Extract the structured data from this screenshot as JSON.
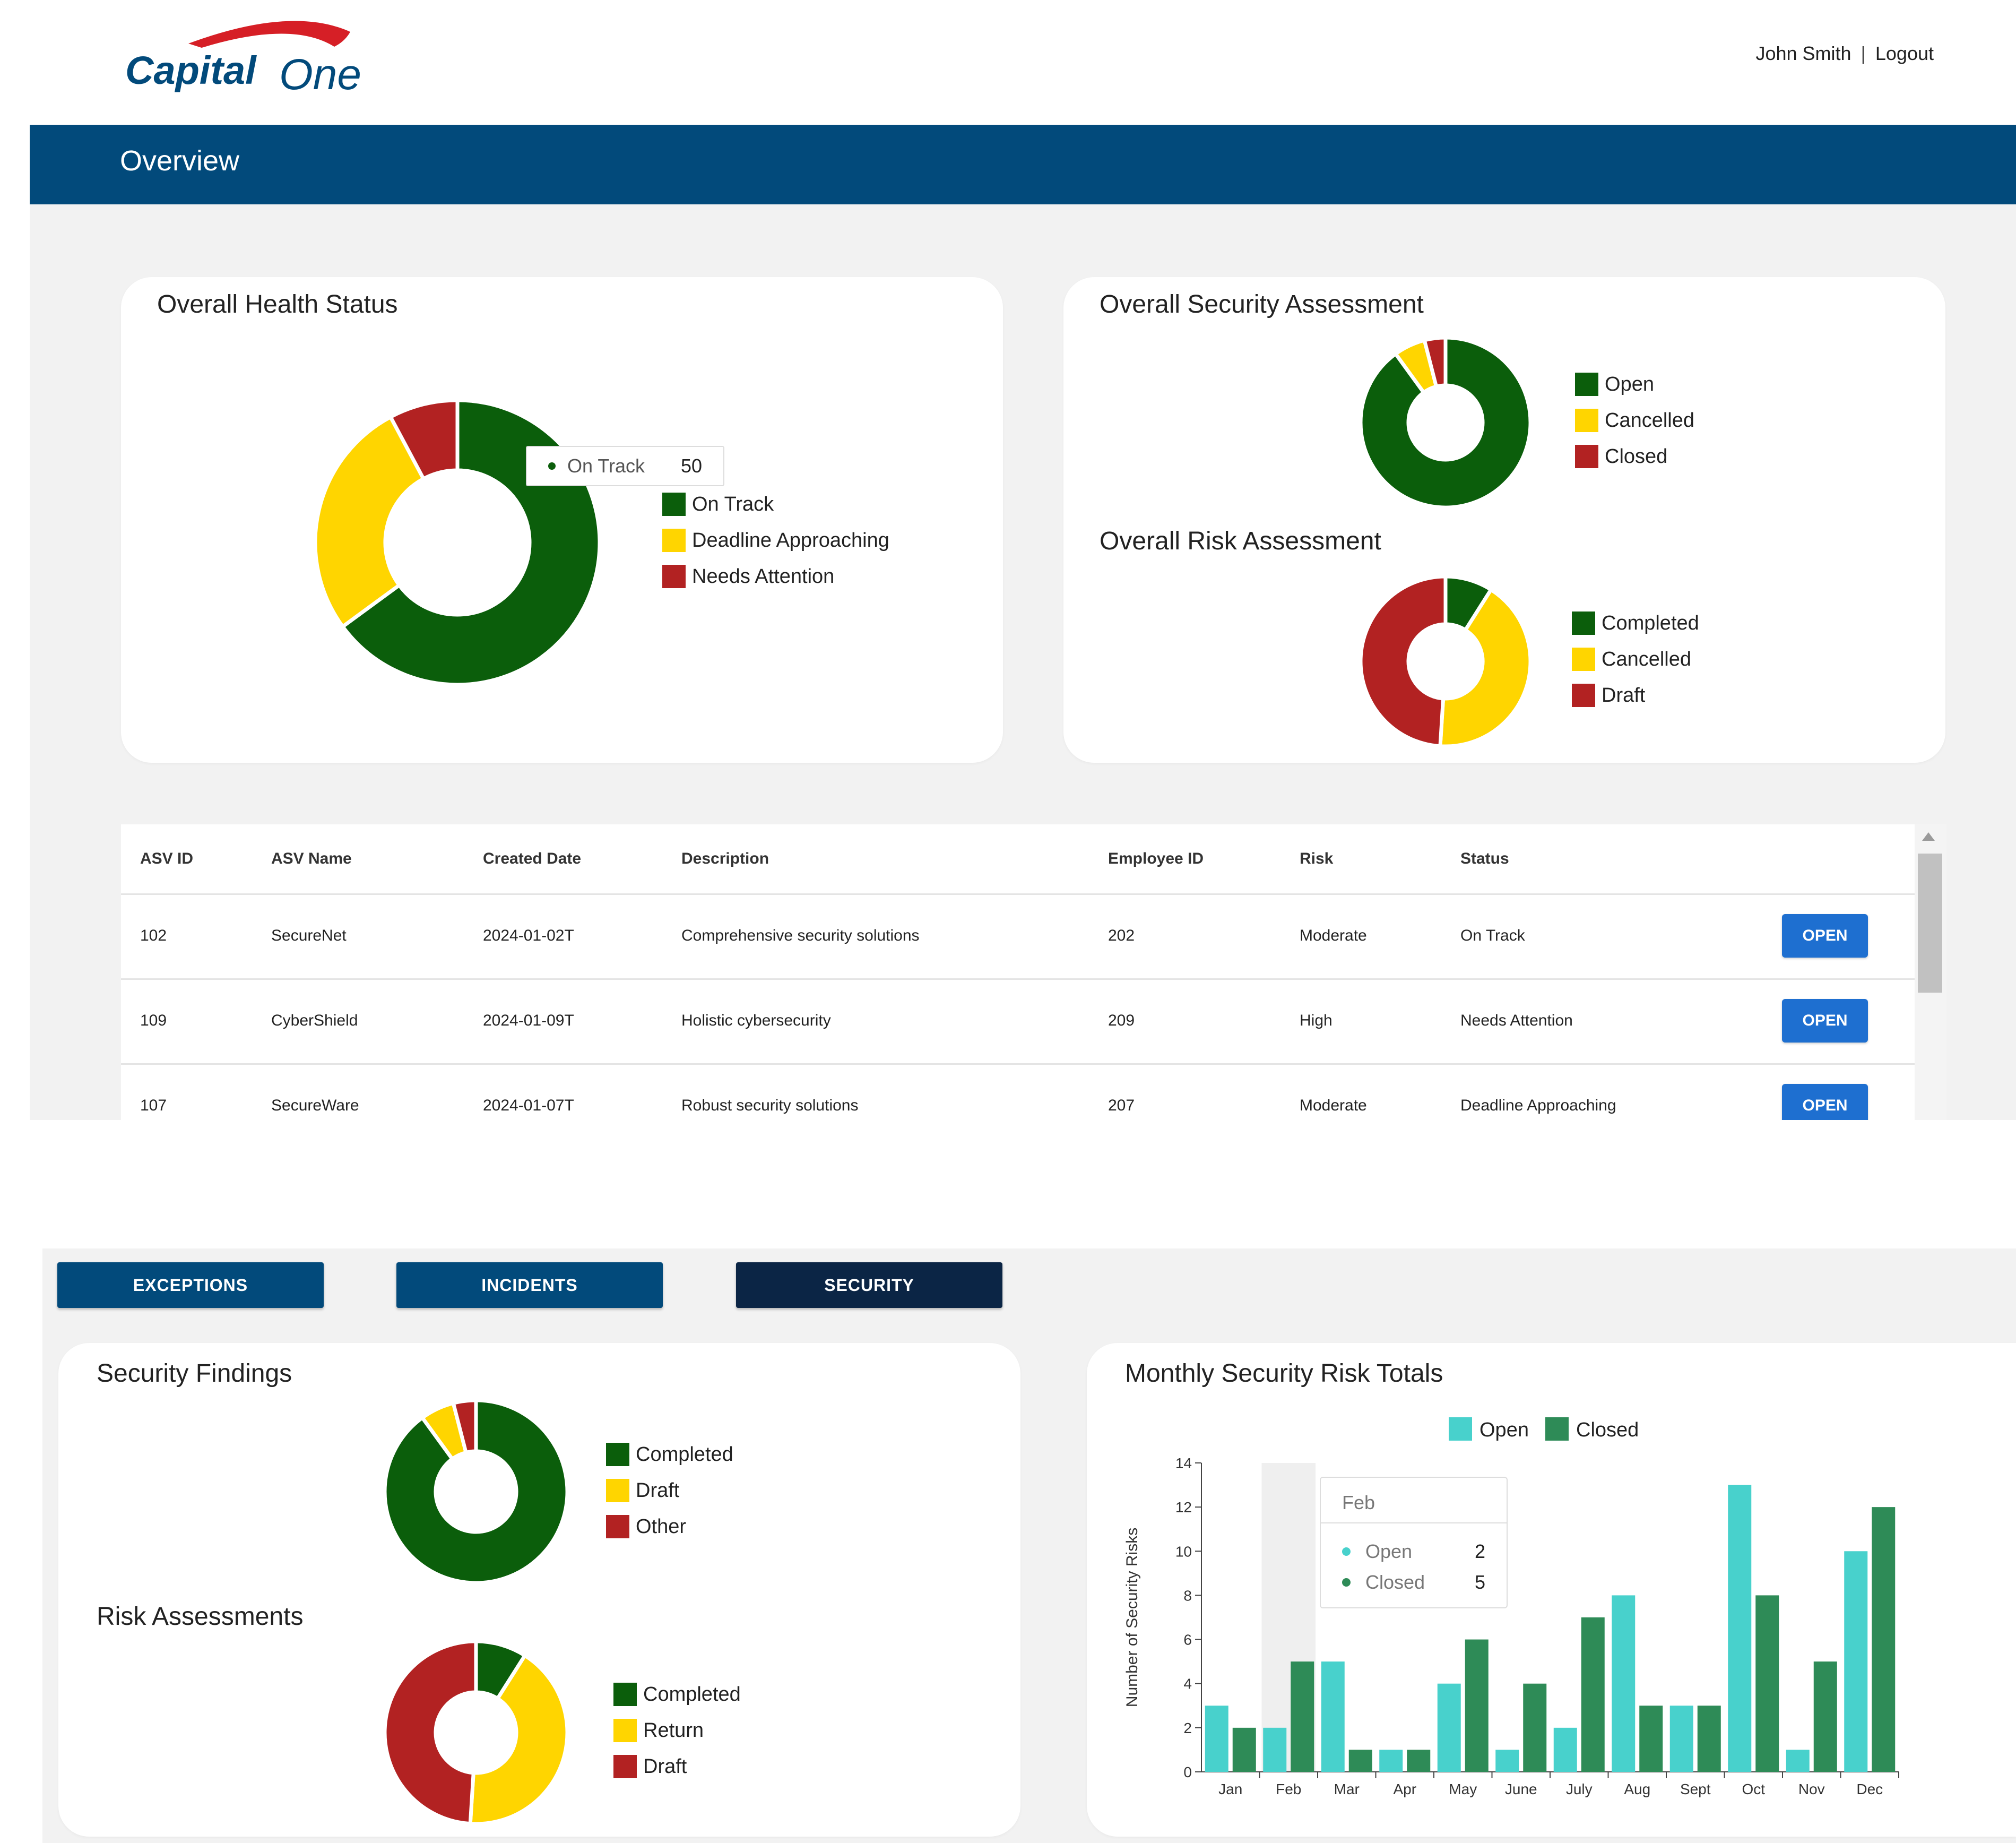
{
  "brand": {
    "logo_text_part1": "Capital",
    "logo_text_part2": "One",
    "swoosh_color": "#d61f26",
    "navy": "#024a7b"
  },
  "header": {
    "user_name": "John Smith",
    "separator": "|",
    "logout_label": "Logout"
  },
  "page": {
    "title": "Overview"
  },
  "health_card": {
    "title": "Overall Health Status",
    "legend": [
      {
        "label": "On Track",
        "color": "#0b5e0b"
      },
      {
        "label": "Deadline Approaching",
        "color": "#ffd500"
      },
      {
        "label": "Needs Attention",
        "color": "#b22222"
      }
    ],
    "tooltip": {
      "label": "On Track",
      "value": "50"
    }
  },
  "security_card": {
    "title": "Overall Security Assessment",
    "legend": [
      {
        "label": "Open",
        "color": "#0b5e0b"
      },
      {
        "label": "Cancelled",
        "color": "#ffd500"
      },
      {
        "label": "Closed",
        "color": "#b22222"
      }
    ],
    "risk_title": "Overall Risk Assessment",
    "risk_legend": [
      {
        "label": "Completed",
        "color": "#0b5e0b"
      },
      {
        "label": "Cancelled",
        "color": "#ffd500"
      },
      {
        "label": "Draft",
        "color": "#b22222"
      }
    ]
  },
  "table": {
    "columns": [
      "ASV ID",
      "ASV Name",
      "Created Date",
      "Description",
      "Employee ID",
      "Risk",
      "Status"
    ],
    "rows": [
      {
        "asv_id": "102",
        "asv_name": "SecureNet",
        "created": "2024-01-02T",
        "description": "Comprehensive security solutions",
        "employee_id": "202",
        "risk": "Moderate",
        "status": "On Track",
        "action": "OPEN"
      },
      {
        "asv_id": "109",
        "asv_name": "CyberShield",
        "created": "2024-01-09T",
        "description": "Holistic cybersecurity",
        "employee_id": "209",
        "risk": "High",
        "status": "Needs Attention",
        "action": "OPEN"
      },
      {
        "asv_id": "107",
        "asv_name": "SecureWare",
        "created": "2024-01-07T",
        "description": "Robust security solutions",
        "employee_id": "207",
        "risk": "Moderate",
        "status": "Deadline Approaching",
        "action": "OPEN"
      }
    ]
  },
  "tabs": [
    {
      "label": "EXCEPTIONS"
    },
    {
      "label": "INCIDENTS"
    },
    {
      "label": "SECURITY",
      "active": true
    }
  ],
  "findings_card": {
    "title": "Security Findings",
    "legend": [
      {
        "label": "Completed",
        "color": "#0b5e0b"
      },
      {
        "label": "Draft",
        "color": "#ffd500"
      },
      {
        "label": "Other",
        "color": "#b22222"
      }
    ],
    "risk_title": "Risk Assessments",
    "risk_legend": [
      {
        "label": "Completed",
        "color": "#0b5e0b"
      },
      {
        "label": "Return",
        "color": "#ffd500"
      },
      {
        "label": "Draft",
        "color": "#b22222"
      }
    ]
  },
  "monthly_card": {
    "title": "Monthly Security Risk Totals",
    "tooltip": {
      "month": "Feb",
      "open_label": "Open",
      "open_value": "2",
      "closed_label": "Closed",
      "closed_value": "5"
    }
  },
  "chart_data": [
    {
      "type": "pie",
      "title": "Overall Health Status",
      "categories": [
        "On Track",
        "Deadline Approaching",
        "Needs Attention"
      ],
      "values": [
        50,
        21,
        6
      ],
      "colors": [
        "#0b5e0b",
        "#ffd500",
        "#b22222"
      ],
      "donut": true,
      "legend": "right"
    },
    {
      "type": "pie",
      "title": "Overall Security Assessment",
      "categories": [
        "Open",
        "Cancelled",
        "Closed"
      ],
      "values": [
        90,
        6,
        4
      ],
      "colors": [
        "#0b5e0b",
        "#ffd500",
        "#b22222"
      ],
      "donut": true,
      "legend": "right"
    },
    {
      "type": "pie",
      "title": "Overall Risk Assessment",
      "categories": [
        "Completed",
        "Cancelled",
        "Draft"
      ],
      "values": [
        9,
        42,
        49
      ],
      "colors": [
        "#0b5e0b",
        "#ffd500",
        "#b22222"
      ],
      "donut": true,
      "legend": "right"
    },
    {
      "type": "pie",
      "title": "Security Findings",
      "categories": [
        "Completed",
        "Draft",
        "Other"
      ],
      "values": [
        90,
        6,
        4
      ],
      "colors": [
        "#0b5e0b",
        "#ffd500",
        "#b22222"
      ],
      "donut": true,
      "legend": "right"
    },
    {
      "type": "pie",
      "title": "Risk Assessments",
      "categories": [
        "Completed",
        "Return",
        "Draft"
      ],
      "values": [
        9,
        42,
        49
      ],
      "colors": [
        "#0b5e0b",
        "#ffd500",
        "#b22222"
      ],
      "donut": true,
      "legend": "right"
    },
    {
      "type": "bar",
      "title": "Monthly Security Risk Totals",
      "categories": [
        "Jan",
        "Feb",
        "Mar",
        "Apr",
        "May",
        "June",
        "July",
        "Aug",
        "Sept",
        "Oct",
        "Nov",
        "Dec"
      ],
      "series": [
        {
          "name": "Open",
          "color": "#48d1cc",
          "values": [
            3,
            2,
            5,
            1,
            4,
            1,
            2,
            8,
            3,
            13,
            1,
            10
          ]
        },
        {
          "name": "Closed",
          "color": "#2e8b57",
          "values": [
            2,
            5,
            1,
            1,
            6,
            4,
            7,
            3,
            3,
            8,
            5,
            12
          ]
        }
      ],
      "ylabel": "Number of Security Risks",
      "xlabel": "",
      "ylim": [
        0,
        14
      ],
      "yticks": [
        0,
        2,
        4,
        6,
        8,
        10,
        12,
        14
      ],
      "legend": "top",
      "highlight_category": "Feb"
    }
  ]
}
